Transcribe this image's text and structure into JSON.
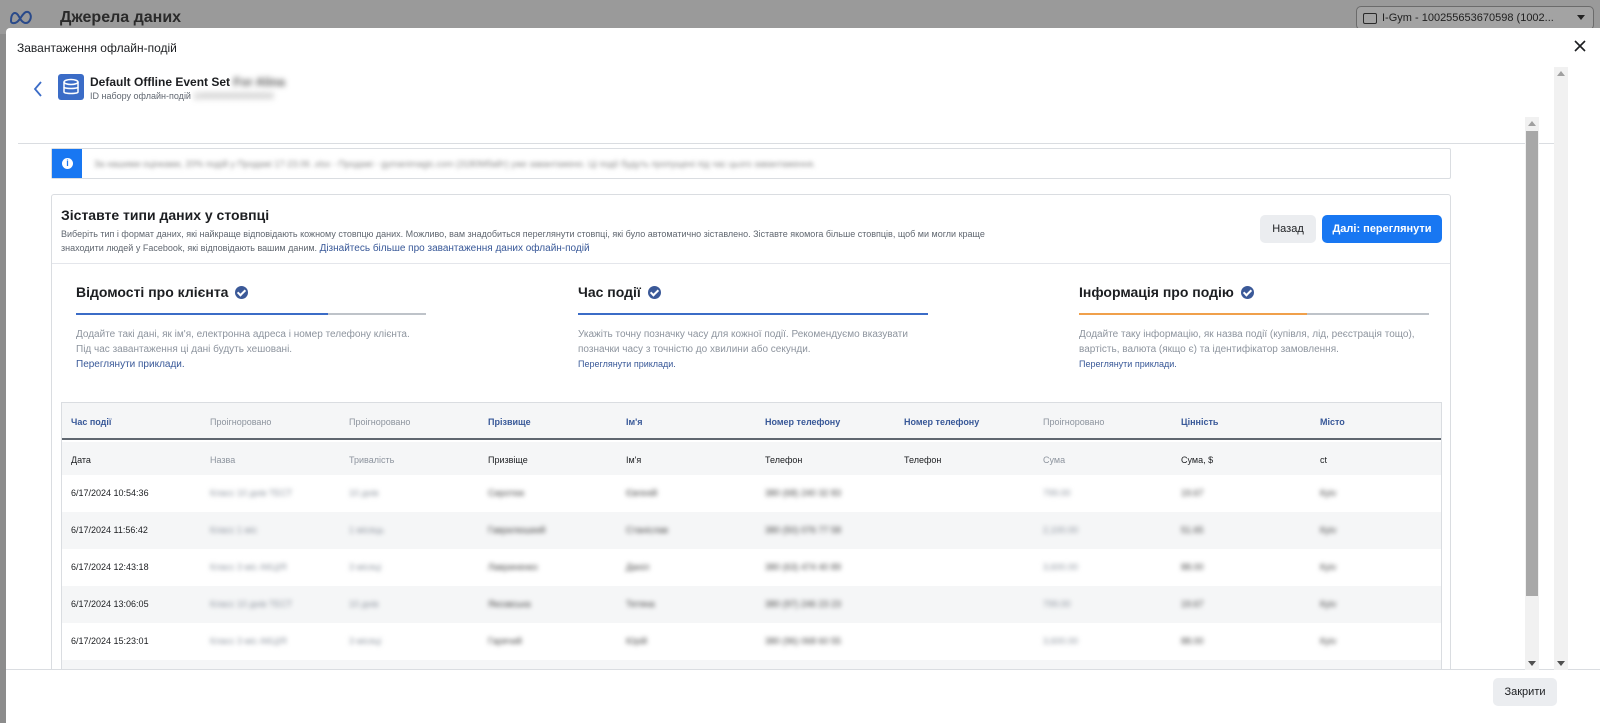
{
  "background": {
    "title": "Джерела даних",
    "account": "I-Gym - 100255653670598 (1002..."
  },
  "modal": {
    "title": "Завантаження офлайн-подій",
    "dataset_name": "Default Offline Event Set",
    "dataset_name_blurred": "For Alina",
    "dataset_id_label": "ID набору офлайн-подій",
    "dataset_id_blurred": "1000000000000000",
    "info_text": "За нашими оцінками, 20% подій у Продажі 17-23.06 .xlsx - Продажі - gymanimagic.com (3180Мбайт) уже завантажено. Ці події будуть пропущені під час цього завантаження.",
    "map_title": "Зіставте типи даних у стовпці",
    "map_desc": "Виберіть тип і формат даних, які найкраще відповідають кожному стовпцю даних. Можливо, вам знадобиться переглянути стовпці, які було автоматично зіставлено. Зіставте якомога більше стовпців, щоб ми могли краще знаходити людей у Facebook, які відповідають вашим даним.",
    "map_link": "Дізнайтесь більше про завантаження даних офлайн-подій",
    "btn_back": "Назад",
    "btn_next": "Далі: переглянути",
    "btn_close": "Закрити"
  },
  "steps": [
    {
      "title": "Відомості про клієнта",
      "desc": "Додайте такі дані, як ім'я, електронна адреса і номер телефону клієнта. Під час завантаження ці дані будуть хешовані.",
      "link": "Переглянути приклади.",
      "progress": 0.72,
      "color": "#3b6cc7"
    },
    {
      "title": "Час події",
      "desc": "Укажіть точну позначку часу для кожної події. Рекомендуємо вказувати позначки часу з точністю до хвилини або секунди.",
      "link": "Переглянути приклади.",
      "progress": 1.0,
      "color": "#3b6cc7"
    },
    {
      "title": "Інформація про подію",
      "desc": "Додайте таку інформацію, як назва події (купівля, лід, реєстрація тощо), вартість, валюта (якщо є) та ідентифікатор замовлення.",
      "link": "Переглянути приклади.",
      "progress": 0.65,
      "color": "#f0a04b"
    }
  ],
  "table": {
    "mapped": [
      "Час події",
      "Проігноровано",
      "Проігноровано",
      "Прізвище",
      "Ім'я",
      "Номер телефону",
      "Номер телефону",
      "Проігноровано",
      "Цінність",
      "Місто"
    ],
    "source": [
      "Дата",
      "Назва",
      "Тривалість",
      "Призвіще",
      "Ім'я",
      "Телефон",
      "Телефон",
      "Сума",
      "Сума, $",
      "ct"
    ],
    "rows": [
      [
        "6/17/2024 10:54:36",
        "Класс 10 днів ТЕСТ",
        "10 днів",
        "Сиротюк",
        "Євгеній",
        "380 (68) 240 32 83",
        "",
        "799.00",
        "19.67",
        "Кyiv"
      ],
      [
        "6/17/2024 11:56:42",
        "Класс 1 міс",
        "1 місяць",
        "Гаврилюшкий",
        "Станіслав",
        "380 (50) 076 77 58",
        "",
        "2,100.00",
        "51.65",
        "Кyiv"
      ],
      [
        "6/17/2024 12:43:18",
        "Класс 3 міс АКЦІЯ",
        "3 місяці",
        "Лавриненко",
        "Даніл",
        "380 (63) 474 40 89",
        "",
        "3,600.00",
        "88.00",
        "Кyiv"
      ],
      [
        "6/17/2024 13:06:05",
        "Класс 10 днів ТЕСТ",
        "10 днів",
        "Якозвська",
        "Тетяна",
        "380 (97) 246 23 23",
        "",
        "799.00",
        "19.67",
        "Кyiv"
      ],
      [
        "6/17/2024 15:23:01",
        "Класс 3 міс АКЦІЯ",
        "3 місяці",
        "Гарячий",
        "Юрій",
        "380 (96) 068 60 55",
        "",
        "3,600.00",
        "88.00",
        "Кyiv"
      ]
    ]
  }
}
